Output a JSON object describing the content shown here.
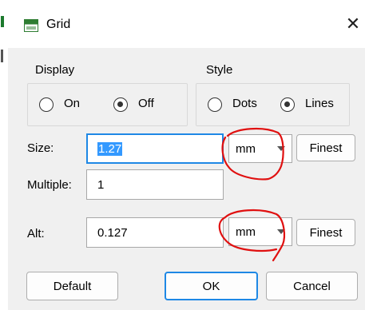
{
  "window": {
    "title": "Grid",
    "icon": "brd-icon",
    "close_glyph": "✕"
  },
  "display": {
    "title": "Display",
    "options": [
      {
        "label": "On",
        "selected": false
      },
      {
        "label": "Off",
        "selected": true
      }
    ]
  },
  "style": {
    "title": "Style",
    "options": [
      {
        "label": "Dots",
        "selected": false
      },
      {
        "label": "Lines",
        "selected": true
      }
    ]
  },
  "size": {
    "label": "Size:",
    "value": "1.27",
    "unit": "mm",
    "finest_label": "Finest"
  },
  "multiple": {
    "label": "Multiple:",
    "value": "1"
  },
  "alt": {
    "label": "Alt:",
    "value": "0.127",
    "unit": "mm",
    "finest_label": "Finest"
  },
  "buttons": {
    "default": "Default",
    "ok": "OK",
    "cancel": "Cancel"
  },
  "colors": {
    "accent": "#1e88e5",
    "annotation": "#e01010",
    "selection": "#3399ff"
  }
}
